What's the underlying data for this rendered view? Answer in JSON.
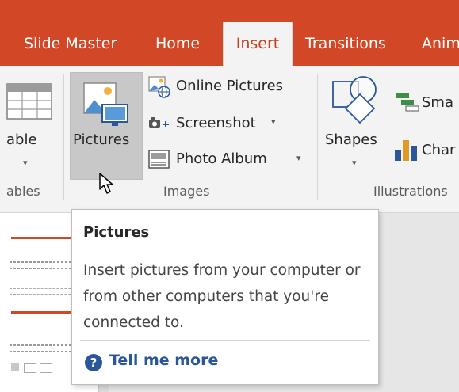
{
  "tabs": [
    {
      "label": "Slide Master",
      "active": false
    },
    {
      "label": "Home",
      "active": false
    },
    {
      "label": "Insert",
      "active": true
    },
    {
      "label": "Transitions",
      "active": false
    },
    {
      "label": "Anim",
      "active": false
    }
  ],
  "ribbon": {
    "groups": {
      "tables": {
        "label": "ables",
        "table_button": "able"
      },
      "images": {
        "label": "Images",
        "pictures_button": "Pictures",
        "online_pictures": "Online Pictures",
        "screenshot": "Screenshot",
        "photo_album": "Photo Album"
      },
      "illustrations": {
        "label": "Illustrations",
        "shapes_button": "Shapes",
        "smartart": "Sma",
        "chart": "Char"
      }
    }
  },
  "tooltip": {
    "title": "Pictures",
    "description": "Insert pictures from your computer or from other computers that you're connected to.",
    "help_link": "Tell me more"
  },
  "colors": {
    "accent": "#d24726",
    "ribbon_bg": "#f3f3f3",
    "link": "#2b579a"
  }
}
